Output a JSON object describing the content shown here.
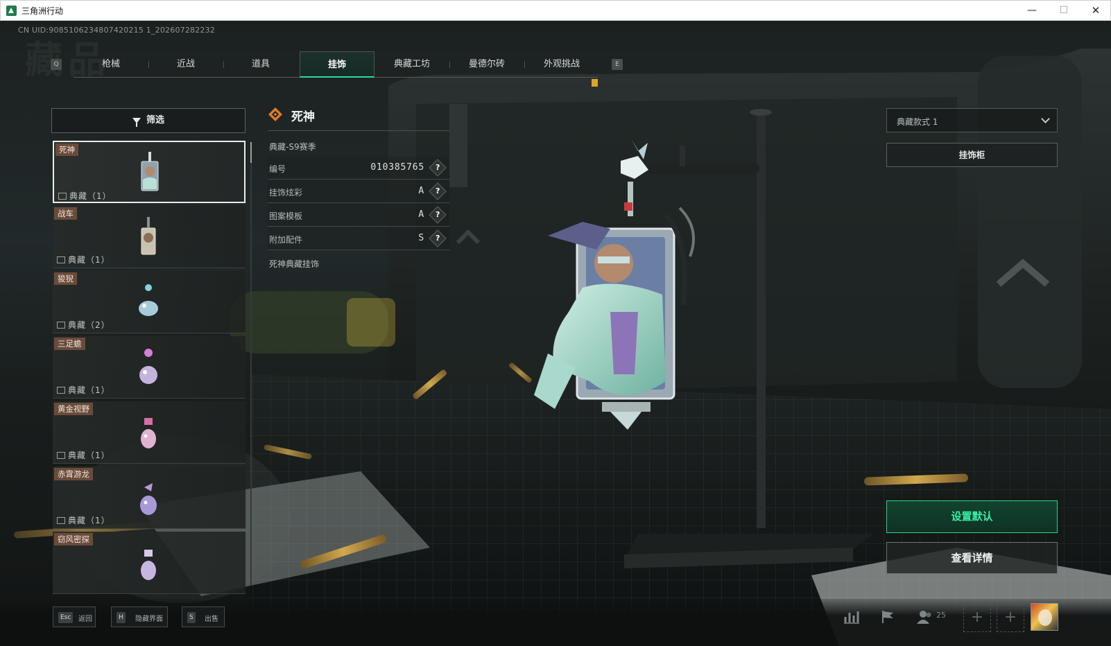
{
  "window": {
    "title": "三角洲行动",
    "minimize": "—",
    "maximize": "☐",
    "close": "✕"
  },
  "uid": "CN UID:9085106234807420215 1_202607282232",
  "watermark": "藏品",
  "tabs": {
    "prev_key": "Q",
    "next_key": "E",
    "items": [
      {
        "label": "枪械"
      },
      {
        "label": "近战"
      },
      {
        "label": "道具"
      },
      {
        "label": "挂饰"
      },
      {
        "label": "典藏工坊"
      },
      {
        "label": "曼德尔砖"
      },
      {
        "label": "外观挑战"
      }
    ],
    "active_index": 3,
    "accent": "#2fd99a"
  },
  "filter": {
    "label": "筛选"
  },
  "list": {
    "items": [
      {
        "name": "死神",
        "tag": "典藏（1）",
        "selected": true
      },
      {
        "name": "战车",
        "tag": "典藏（1）"
      },
      {
        "name": "狻猊",
        "tag": "典藏（2）"
      },
      {
        "name": "三足蟾",
        "tag": "典藏（1）"
      },
      {
        "name": "黄金视野",
        "tag": "典藏（1）"
      },
      {
        "name": "赤霄游龙",
        "tag": "典藏（1）"
      },
      {
        "name": "窃风密探",
        "tag": ""
      }
    ]
  },
  "info": {
    "title": "死神",
    "season": "典藏-S9赛季",
    "rows": [
      {
        "label": "编号",
        "value": "010385765"
      },
      {
        "label": "挂饰炫彩",
        "value": "A"
      },
      {
        "label": "图案模板",
        "value": "A"
      },
      {
        "label": "附加配件",
        "value": "S"
      }
    ],
    "help": "?",
    "description": "死神典藏挂饰"
  },
  "right": {
    "style_select": "典藏款式 1",
    "cabinet": "挂饰柜",
    "set_default": "设置默认",
    "details": "查看详情"
  },
  "bottom": {
    "back": {
      "key": "Esc",
      "label": "返回"
    },
    "hide_ui": {
      "key": "H",
      "label": "隐藏界面"
    },
    "sell": {
      "key": "S",
      "label": "出售"
    },
    "friends_count": "25",
    "slot_plus": "+"
  }
}
